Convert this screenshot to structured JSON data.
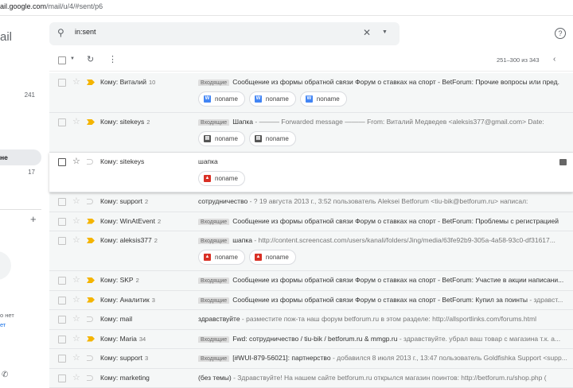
{
  "url": {
    "host": "ail.google.com",
    "path": "/mail/u/4/#sent/p6"
  },
  "sidebar": {
    "logo": "ail",
    "count1": "241",
    "selected": "не",
    "count2": "17",
    "plus": "+",
    "note1": "о нет",
    "note2": "ет"
  },
  "search": {
    "value": "in:sent"
  },
  "toolbar": {
    "pagination": "251–300 из 343"
  },
  "label_inbox": "Входящие",
  "rows": [
    {
      "sender": "Кому: Виталий",
      "count": "10",
      "important": true,
      "label": true,
      "subject": "Сообщение из формы обратной связи Форум о ставках на спорт - BetForum: Прочие вопросы или пред.",
      "preview": "",
      "att": [
        {
          "t": "word",
          "name": "noname"
        },
        {
          "t": "word",
          "name": "noname"
        },
        {
          "t": "word",
          "name": "noname"
        }
      ]
    },
    {
      "sender": "Кому: sitekeys",
      "count": "2",
      "important": true,
      "label": true,
      "subject": "Шапка",
      "preview": " - ——— Forwarded message ——— From: Виталий Медведев <aleksis377@gmail.com> Date:",
      "att": [
        {
          "t": "arch",
          "name": "noname"
        },
        {
          "t": "arch",
          "name": "noname"
        }
      ]
    },
    {
      "sender": "Кому: sitekeys",
      "count": "",
      "important": false,
      "label": false,
      "subject": "шапка",
      "preview": "",
      "att": [
        {
          "t": "img",
          "name": "noname"
        }
      ],
      "hover": true
    },
    {
      "sender": "Кому: support",
      "count": "2",
      "important": false,
      "label": false,
      "subject": "сотрудничество",
      "preview": " - ? 19 августа 2013 г., 3:52 пользователь Aleksei Betforum <tiu-bik@betforum.ru> написал:",
      "att": []
    },
    {
      "sender": "Кому: WinAtEvent",
      "count": "2",
      "important": true,
      "label": true,
      "subject": "Сообщение из формы обратной связи Форум о ставках на спорт - BetForum: Проблемы с регистрацией",
      "preview": "",
      "att": []
    },
    {
      "sender": "Кому: aleksis377",
      "count": "2",
      "important": true,
      "label": true,
      "subject": "шапка",
      "preview": " - http://content.screencast.com/users/kanali/folders/Jing/media/63fe92b9-305a-4a58-93c0-df31617...",
      "att": [
        {
          "t": "img",
          "name": "noname"
        },
        {
          "t": "img",
          "name": "noname"
        }
      ]
    },
    {
      "sender": "Кому: SKP",
      "count": "2",
      "important": true,
      "label": true,
      "subject": "Сообщение из формы обратной связи Форум о ставках на спорт - BetForum: Участие в акции написани...",
      "preview": "",
      "att": []
    },
    {
      "sender": "Кому: Аналитик",
      "count": "3",
      "important": true,
      "label": true,
      "subject": "Сообщение из формы обратной связи Форум о ставках на спорт - BetForum: Купил за поинты",
      "preview": " - здравст...",
      "att": []
    },
    {
      "sender": "Кому: mail",
      "count": "",
      "important": false,
      "label": false,
      "subject": "здравствуйте",
      "preview": " - разместите пож-та наш форум betforum.ru в этом разделе: http://allsportlinks.com/forums.html",
      "att": []
    },
    {
      "sender": "Кому: Maria",
      "count": "34",
      "important": true,
      "label": true,
      "subject": "Fwd: сотрудничество / tiu-bik / betforum.ru & mmgp.ru",
      "preview": " - здравствуйте. убрал ваш товар с магазина т.к. а...",
      "att": []
    },
    {
      "sender": "Кому: support",
      "count": "3",
      "important": false,
      "label": true,
      "subject": "[#WUI-879-56021]: партнерство",
      "preview": " - добавился 8 июля 2013 г., 13:47 пользователь Goldfishka Support <supp...",
      "att": []
    },
    {
      "sender": "Кому: marketing",
      "count": "",
      "important": false,
      "label": false,
      "subject": "(без темы)",
      "preview": " - Здравствуйте! На нашем сайте betforum.ru открылся магазин поинтов: http://betforum.ru/shop.php (",
      "att": []
    }
  ]
}
